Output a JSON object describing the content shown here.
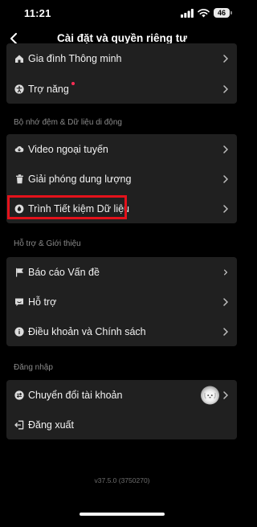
{
  "status_bar": {
    "time": "11:21",
    "battery": "46",
    "icons": [
      "signal-icon",
      "wifi-icon",
      "battery-icon"
    ]
  },
  "header": {
    "title": "Cài đặt và quyền riêng tư",
    "back_icon": "chevron-left-icon"
  },
  "top_card": {
    "items": [
      {
        "label": "Gia đình Thông minh",
        "icon": "home-icon"
      },
      {
        "label": "Trợ năng",
        "icon": "accessibility-icon"
      }
    ]
  },
  "cache_section": {
    "header": "Bộ nhớ đệm & Dữ liệu di động",
    "items": [
      {
        "label": "Video ngoại tuyến",
        "icon": "download-cloud-icon"
      },
      {
        "label": "Giải phóng dung lượng",
        "icon": "trash-icon"
      },
      {
        "label": "Trình Tiết kiệm Dữ liệu",
        "icon": "data-saver-icon"
      }
    ]
  },
  "support_section": {
    "header": "Hỗ trợ & Giới thiệu",
    "items": [
      {
        "label": "Báo cáo Vấn đề",
        "icon": "flag-icon"
      },
      {
        "label": "Hỗ trợ",
        "icon": "help-chat-icon"
      },
      {
        "label": "Điều khoản và Chính sách",
        "icon": "info-icon"
      }
    ]
  },
  "login_section": {
    "header": "Đăng nhập",
    "items": [
      {
        "label": "Chuyển đổi tài khoản",
        "icon": "switch-account-icon"
      },
      {
        "label": "Đăng xuất",
        "icon": "logout-icon"
      }
    ]
  },
  "version": "v37.5.0 (3750270)",
  "colors": {
    "background": "#000000",
    "card": "#202020",
    "highlight": "#e3121b",
    "notification_dot": "#ff2d55",
    "section_header": "#8a8a8a"
  }
}
